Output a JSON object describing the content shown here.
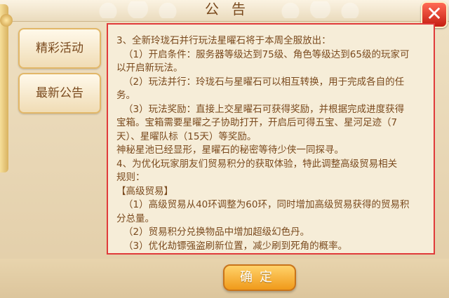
{
  "window": {
    "title": "公告",
    "close_label": "✕"
  },
  "sidebar": {
    "items": [
      {
        "label": "精彩活动"
      },
      {
        "label": "最新公告"
      }
    ]
  },
  "announcement": {
    "lines": [
      "3、全新玲珑石并行玩法星曜石将于本周全服放出：",
      "（1）开启条件：服务器等级达到75级、角色等级达到65级的玩家可",
      "以开启新玩法。",
      "（2）玩法并行：玲珑石与星曜石可以相互转换，用于完成各自的任",
      "务。",
      "（3）玩法奖励：直接上交星曜石可获得奖励，并根据完成进度获得",
      "宝箱。宝箱需要星曜之子协助打开，开启后可得五宝、星河足迹（7",
      "天）、星曜队标（15天）等奖励。",
      "神秘星池已经显形，星曜石的秘密等待少侠一同探寻。",
      "4、为优化玩家朋友们贸易积分的获取体验，特此调整高级贸易相关",
      "规则：",
      "【高级贸易】",
      "（1）高级贸易从40环调整为60环，同时增加高级贸易获得的贸易积",
      "分总量。",
      "（2）贸易积分兑换物品中增加超级幻色丹。",
      "（3）优化劫镖强盗刷新位置，减少刷到死角的概率。"
    ]
  },
  "footer": {
    "confirm_label": "确定"
  },
  "colors": {
    "text": "#7a4a1e",
    "highlight_border": "#e03a3a",
    "confirm": "#f2a227",
    "close": "#d9291b"
  }
}
